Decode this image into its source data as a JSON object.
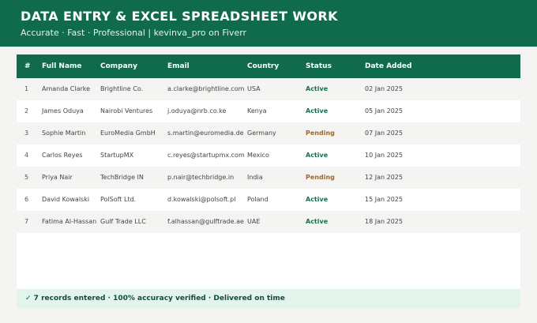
{
  "header": {
    "title": "DATA ENTRY & EXCEL SPREADSHEET WORK",
    "subtitle": "Accurate · Fast · Professional  |  kevinva_pro on Fiverr"
  },
  "table": {
    "columns": [
      "#",
      "Full Name",
      "Company",
      "Email",
      "Country",
      "Status",
      "Date Added"
    ],
    "rows": [
      [
        "1",
        "Amanda Clarke",
        "Brightline Co.",
        "a.clarke@brightline.com",
        "USA",
        "Active",
        "02 Jan 2025"
      ],
      [
        "2",
        "James Oduya",
        "Nairobi Ventures",
        "j.oduya@nrb.co.ke",
        "Kenya",
        "Active",
        "05 Jan 2025"
      ],
      [
        "3",
        "Sophie Martin",
        "EuroMedia GmbH",
        "s.martin@euromedia.de",
        "Germany",
        "Pending",
        "07 Jan 2025"
      ],
      [
        "4",
        "Carlos Reyes",
        "StartupMX",
        "c.reyes@startupmx.com",
        "Mexico",
        "Active",
        "10 Jan 2025"
      ],
      [
        "5",
        "Priya Nair",
        "TechBridge IN",
        "p.nair@techbridge.in",
        "India",
        "Pending",
        "12 Jan 2025"
      ],
      [
        "6",
        "David Kowalski",
        "PolSoft Ltd.",
        "d.kowalski@polsoft.pl",
        "Poland",
        "Active",
        "15 Jan 2025"
      ],
      [
        "7",
        "Fatima Al-Hassan",
        "Gulf Trade LLC",
        "f.alhassan@gulftrade.ae",
        "UAE",
        "Active",
        "18 Jan 2025"
      ]
    ]
  },
  "footer": {
    "text": "✓  7 records entered   ·   100% accuracy verified   ·   Delivered on time"
  },
  "colors": {
    "brand": "#106b4d",
    "active": "#16704f",
    "pending": "#9a6a2e",
    "footer_bg": "#e3f4ec"
  }
}
